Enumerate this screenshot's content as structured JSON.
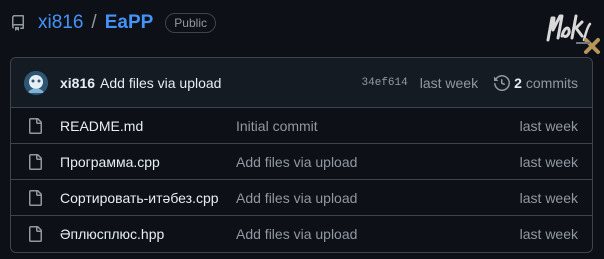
{
  "repo": {
    "owner": "xi816",
    "separator": "/",
    "name": "EaPP",
    "visibility": "Public"
  },
  "icons": {
    "repo": "repo-icon",
    "file": "file-icon",
    "history": "history-icon"
  },
  "latest_commit": {
    "author": "xi816",
    "message": "Add files via upload",
    "sha": "34ef614",
    "time": "last week",
    "count": "2",
    "count_label": "commits"
  },
  "files": [
    {
      "name": "README.md",
      "message": "Initial commit",
      "time": "last week"
    },
    {
      "name": "Программа.cpp",
      "message": "Add files via upload",
      "time": "last week"
    },
    {
      "name": "Сортировать-итəбез.cpp",
      "message": "Add files via upload",
      "time": "last week"
    },
    {
      "name": "Әплюсплюс.hpp",
      "message": "Add files via upload",
      "time": "last week"
    }
  ],
  "colors": {
    "background": "#0d1117",
    "header_bg": "#151b23",
    "border": "#3d444d",
    "link": "#4493f8",
    "muted": "#9198a1",
    "text": "#e6edf3"
  }
}
